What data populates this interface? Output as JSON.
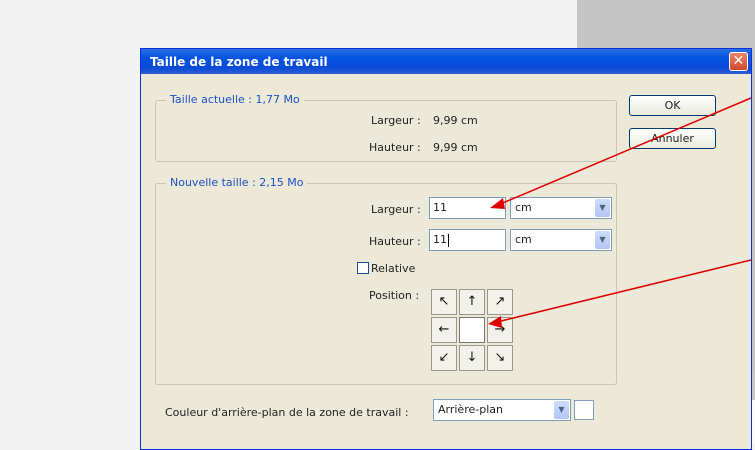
{
  "dialog": {
    "title": "Taille de la zone de travail",
    "close_glyph": "✕",
    "current": {
      "legend": "Taille actuelle : 1,77 Mo",
      "width_label": "Largeur :",
      "width_value": "9,99 cm",
      "height_label": "Hauteur :",
      "height_value": "9,99 cm"
    },
    "new": {
      "legend": "Nouvelle taille : 2,15 Mo",
      "width_label": "Largeur :",
      "width_value": "11",
      "width_unit": "cm",
      "height_label": "Hauteur :",
      "height_value": "11",
      "height_unit": "cm",
      "relative_label": "Relative",
      "relative_checked": false,
      "position_label": "Position :"
    },
    "anchor": {
      "nw": "↖",
      "n": "↑",
      "ne": "↗",
      "w": "←",
      "e": "→",
      "sw": "↙",
      "s": "↓",
      "se": "↘"
    },
    "ok_label": "OK",
    "cancel_label": "Annuler",
    "background": {
      "label": "Couleur d'arrière-plan de la zone de travail :",
      "value": "Arrière-plan"
    },
    "dropdown_arrow": "▼"
  },
  "colors": {
    "title_bar": "#0554e3",
    "annotation_arrow": "#e00000"
  }
}
